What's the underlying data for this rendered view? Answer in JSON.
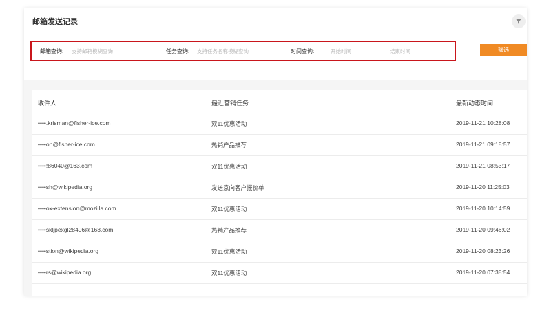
{
  "page": {
    "title": "邮箱发送记录"
  },
  "search": {
    "email_label": "邮箱查询:",
    "email_placeholder": "支持邮箱模糊查询",
    "task_label": "任务查询:",
    "task_placeholder": "支持任务名称模糊查询",
    "time_label": "时间查询:",
    "start_placeholder": "开始时间",
    "end_placeholder": "结束时间",
    "filter_button": "筛选"
  },
  "icons": {
    "filter": "funnel-icon"
  },
  "colors": {
    "accent": "#f08a24",
    "highlight": "#c9161c"
  },
  "table": {
    "headers": [
      "收件人",
      "最近营销任务",
      "最新动态时间"
    ],
    "rows": [
      {
        "recipient": "••••.krisman@fisher-ice.com",
        "task": "双11优惠活动",
        "time": "2019-11-21 10:28:08"
      },
      {
        "recipient": "••••on@fisher-ice.com",
        "task": "热销产品推荐",
        "time": "2019-11-21 09:18:57"
      },
      {
        "recipient": "••••!86040@163.com",
        "task": "双11优惠活动",
        "time": "2019-11-21 08:53:17"
      },
      {
        "recipient": "••••sh@wikipedia.org",
        "task": "发送意向客户报价单",
        "time": "2019-11-20 11:25:03"
      },
      {
        "recipient": "••••ox-extension@mozilla.com",
        "task": "双11优惠活动",
        "time": "2019-11-20 10:14:59"
      },
      {
        "recipient": "••••skljpexgl28406@163.com",
        "task": "热销产品推荐",
        "time": "2019-11-20 09:46:02"
      },
      {
        "recipient": "••••stion@wikipedia.org",
        "task": "双11优惠活动",
        "time": "2019-11-20 08:23:26"
      },
      {
        "recipient": "••••rs@wikipedia.org",
        "task": "双11优惠活动",
        "time": "2019-11-20 07:38:54"
      }
    ]
  }
}
